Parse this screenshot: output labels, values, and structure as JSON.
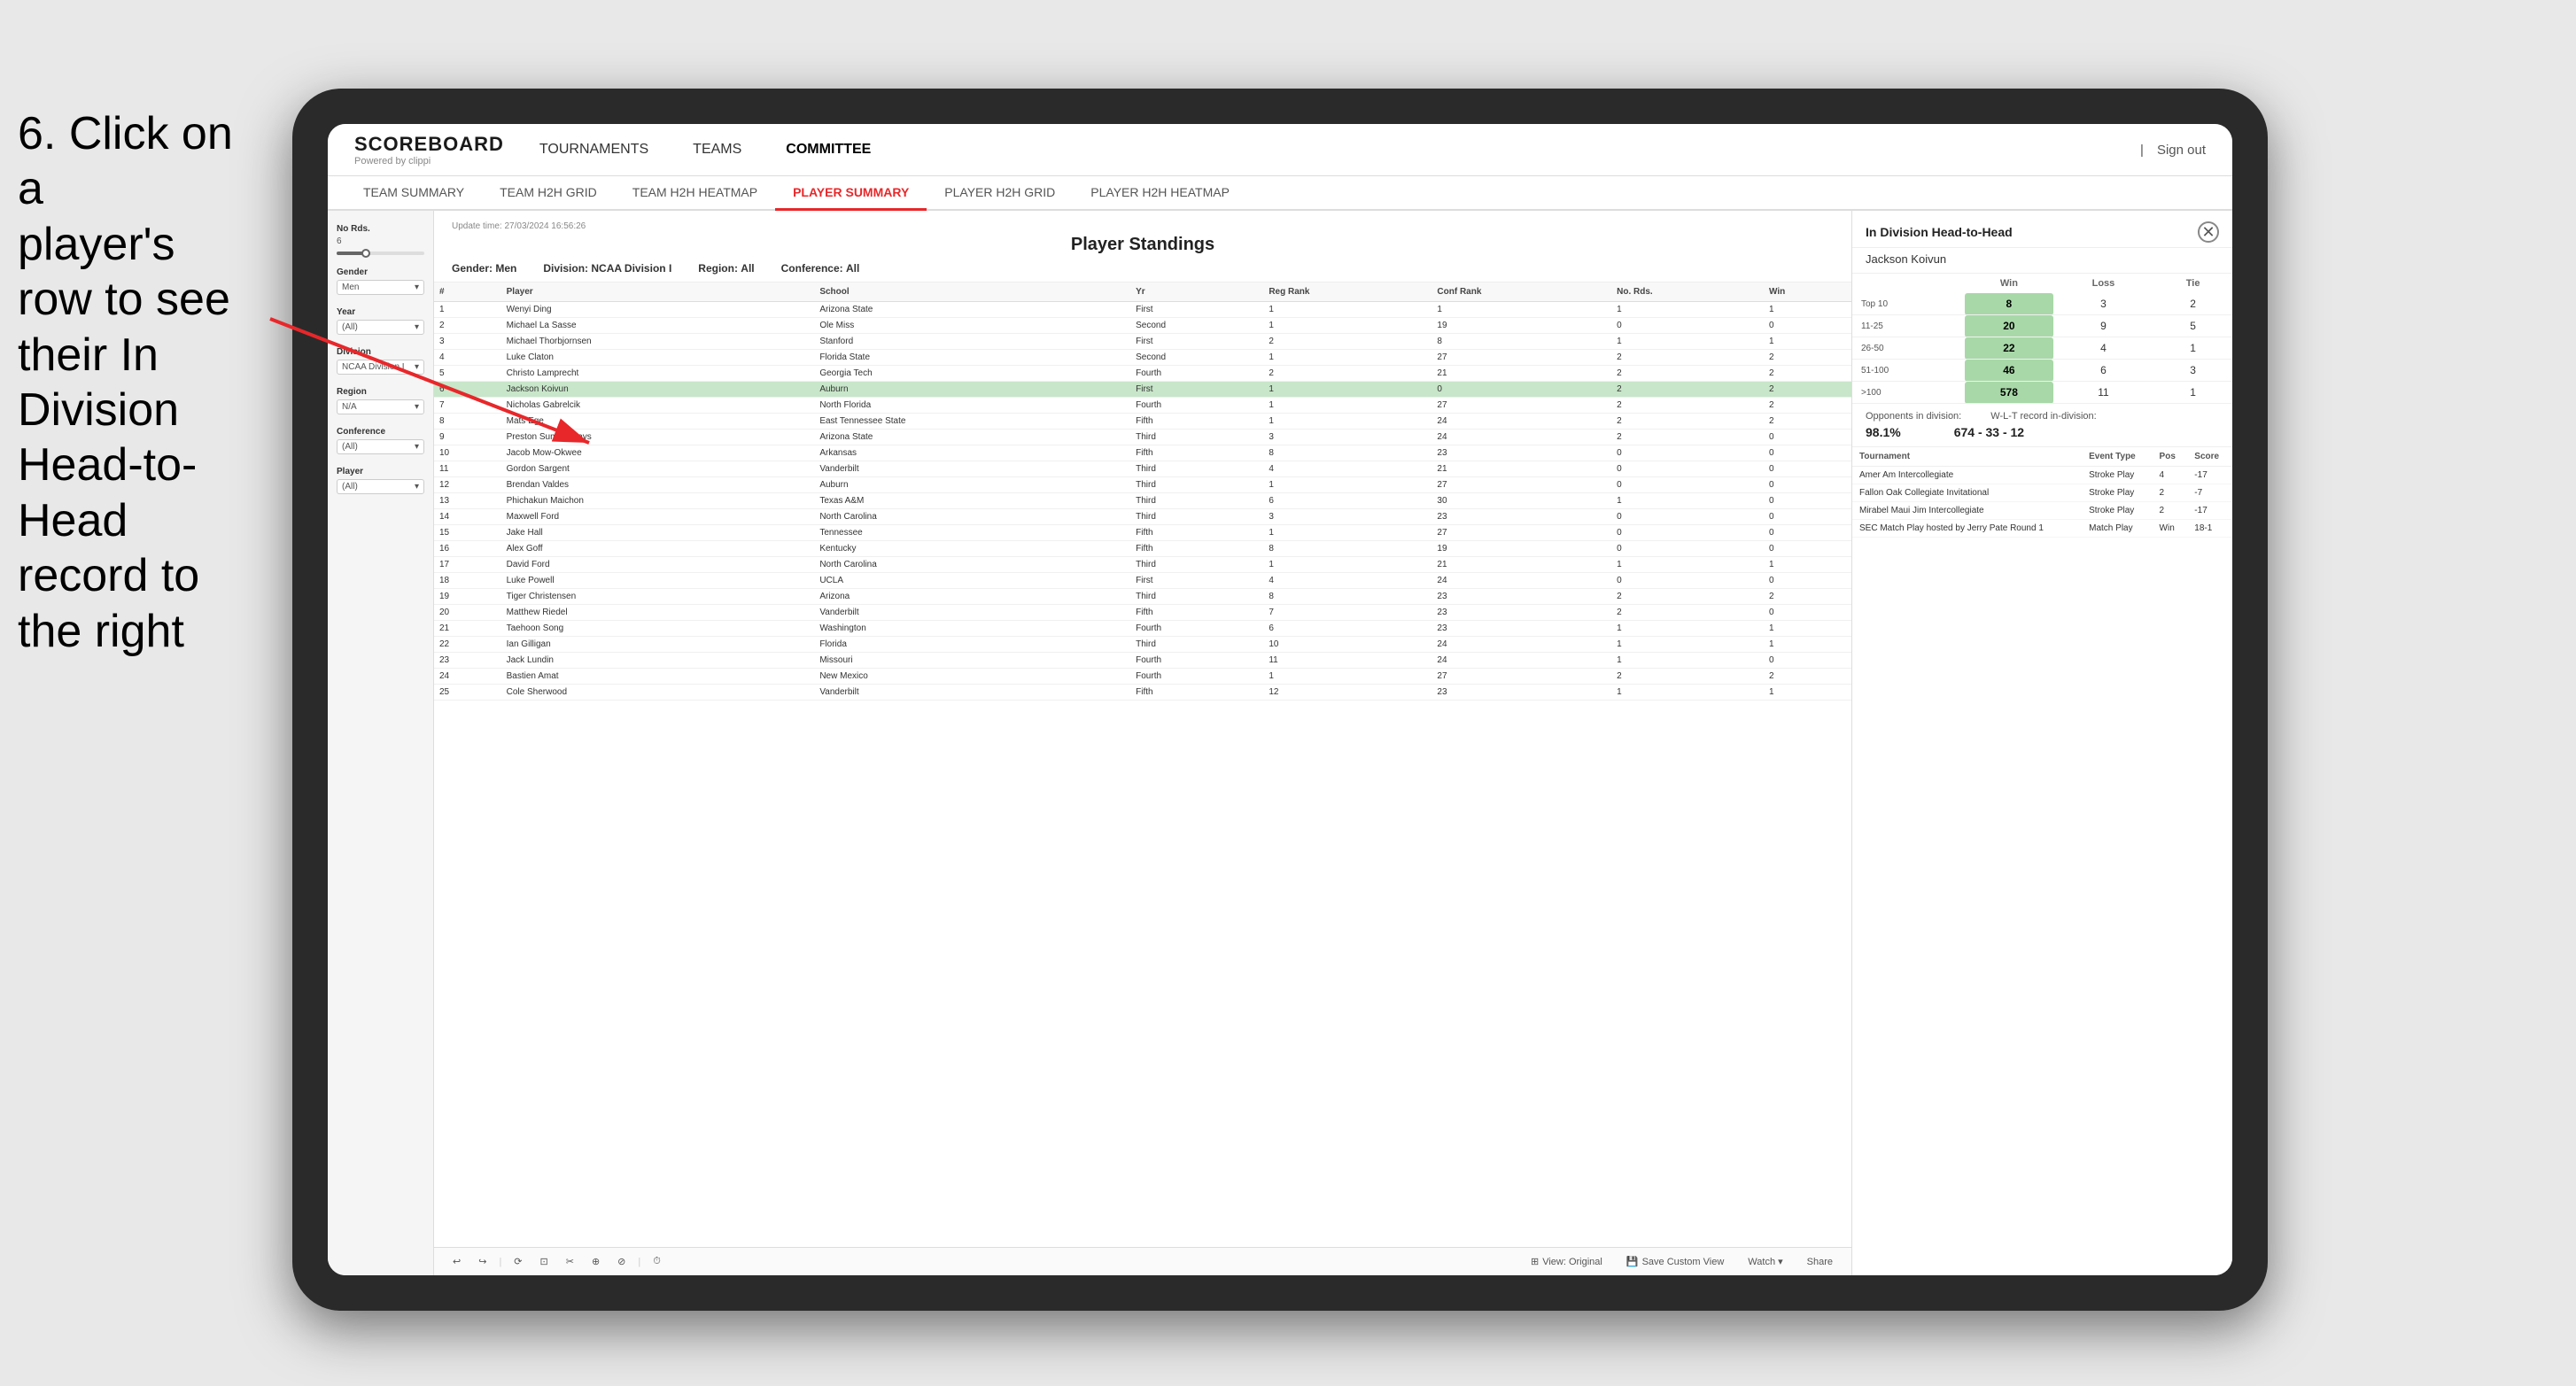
{
  "instruction": {
    "line1": "6. Click on a",
    "line2": "player's row to see",
    "line3": "their In Division",
    "line4": "Head-to-Head",
    "line5": "record to the right"
  },
  "nav": {
    "logo_main": "SCOREBOARD",
    "logo_sub": "Powered by clippi",
    "items": [
      "TOURNAMENTS",
      "TEAMS",
      "COMMITTEE"
    ],
    "sign_out": "Sign out"
  },
  "subnav": {
    "items": [
      "TEAM SUMMARY",
      "TEAM H2H GRID",
      "TEAM H2H HEATMAP",
      "PLAYER SUMMARY",
      "PLAYER H2H GRID",
      "PLAYER H2H HEATMAP"
    ],
    "active": "PLAYER SUMMARY"
  },
  "filters": {
    "no_rds_label": "No Rds.",
    "no_rds_value": "6",
    "gender_label": "Gender",
    "gender_value": "Men",
    "year_label": "Year",
    "year_value": "(All)",
    "division_label": "Division",
    "division_value": "NCAA Division I",
    "region_label": "Region",
    "region_value": "N/A",
    "conference_label": "Conference",
    "conference_value": "(All)",
    "player_label": "Player",
    "player_value": "(All)"
  },
  "table": {
    "update_time": "Update time:",
    "update_datetime": "27/03/2024 16:56:26",
    "title": "Player Standings",
    "gender_label": "Gender:",
    "gender_value": "Men",
    "division_label": "Division:",
    "division_value": "NCAA Division I",
    "region_label": "Region:",
    "region_value": "All",
    "conference_label": "Conference:",
    "conference_value": "All",
    "columns": [
      "#",
      "Player",
      "School",
      "Yr",
      "Reg Rank",
      "Conf Rank",
      "No. Rds.",
      "Win"
    ],
    "rows": [
      {
        "num": 1,
        "player": "Wenyi Ding",
        "school": "Arizona State",
        "yr": "First",
        "reg": 1,
        "conf": 1,
        "rds": 1,
        "win": 1
      },
      {
        "num": 2,
        "player": "Michael La Sasse",
        "school": "Ole Miss",
        "yr": "Second",
        "reg": 1,
        "conf": 19,
        "rds": 0,
        "win": 0
      },
      {
        "num": 3,
        "player": "Michael Thorbjornsen",
        "school": "Stanford",
        "yr": "First",
        "reg": 2,
        "conf": 8,
        "rds": 1,
        "win": 1
      },
      {
        "num": 4,
        "player": "Luke Claton",
        "school": "Florida State",
        "yr": "Second",
        "reg": 1,
        "conf": 27,
        "rds": 2,
        "win": 2
      },
      {
        "num": 5,
        "player": "Christo Lamprecht",
        "school": "Georgia Tech",
        "yr": "Fourth",
        "reg": 2,
        "conf": 21,
        "rds": 2,
        "win": 2
      },
      {
        "num": 6,
        "player": "Jackson Koivun",
        "school": "Auburn",
        "yr": "First",
        "reg": 1,
        "conf": 0,
        "rds": 2,
        "win": 2
      },
      {
        "num": 7,
        "player": "Nicholas Gabrelcik",
        "school": "North Florida",
        "yr": "Fourth",
        "reg": 1,
        "conf": 27,
        "rds": 2,
        "win": 2
      },
      {
        "num": 8,
        "player": "Mats Ege",
        "school": "East Tennessee State",
        "yr": "Fifth",
        "reg": 1,
        "conf": 24,
        "rds": 2,
        "win": 2
      },
      {
        "num": 9,
        "player": "Preston Summerhays",
        "school": "Arizona State",
        "yr": "Third",
        "reg": 3,
        "conf": 24,
        "rds": 2,
        "win": 0
      },
      {
        "num": 10,
        "player": "Jacob Mow-Okwee",
        "school": "Arkansas",
        "yr": "Fifth",
        "reg": 8,
        "conf": 23,
        "rds": 0,
        "win": 0
      },
      {
        "num": 11,
        "player": "Gordon Sargent",
        "school": "Vanderbilt",
        "yr": "Third",
        "reg": 4,
        "conf": 21,
        "rds": 0,
        "win": 0
      },
      {
        "num": 12,
        "player": "Brendan Valdes",
        "school": "Auburn",
        "yr": "Third",
        "reg": 1,
        "conf": 27,
        "rds": 0,
        "win": 0
      },
      {
        "num": 13,
        "player": "Phichakun Maichon",
        "school": "Texas A&M",
        "yr": "Third",
        "reg": 6,
        "conf": 30,
        "rds": 1,
        "win": 0
      },
      {
        "num": 14,
        "player": "Maxwell Ford",
        "school": "North Carolina",
        "yr": "Third",
        "reg": 3,
        "conf": 23,
        "rds": 0,
        "win": 0
      },
      {
        "num": 15,
        "player": "Jake Hall",
        "school": "Tennessee",
        "yr": "Fifth",
        "reg": 1,
        "conf": 27,
        "rds": 0,
        "win": 0
      },
      {
        "num": 16,
        "player": "Alex Goff",
        "school": "Kentucky",
        "yr": "Fifth",
        "reg": 8,
        "conf": 19,
        "rds": 0,
        "win": 0
      },
      {
        "num": 17,
        "player": "David Ford",
        "school": "North Carolina",
        "yr": "Third",
        "reg": 1,
        "conf": 21,
        "rds": 1,
        "win": 1
      },
      {
        "num": 18,
        "player": "Luke Powell",
        "school": "UCLA",
        "yr": "First",
        "reg": 4,
        "conf": 24,
        "rds": 0,
        "win": 0
      },
      {
        "num": 19,
        "player": "Tiger Christensen",
        "school": "Arizona",
        "yr": "Third",
        "reg": 8,
        "conf": 23,
        "rds": 2,
        "win": 2
      },
      {
        "num": 20,
        "player": "Matthew Riedel",
        "school": "Vanderbilt",
        "yr": "Fifth",
        "reg": 7,
        "conf": 23,
        "rds": 2,
        "win": 0
      },
      {
        "num": 21,
        "player": "Taehoon Song",
        "school": "Washington",
        "yr": "Fourth",
        "reg": 6,
        "conf": 23,
        "rds": 1,
        "win": 1
      },
      {
        "num": 22,
        "player": "Ian Gilligan",
        "school": "Florida",
        "yr": "Third",
        "reg": 10,
        "conf": 24,
        "rds": 1,
        "win": 1
      },
      {
        "num": 23,
        "player": "Jack Lundin",
        "school": "Missouri",
        "yr": "Fourth",
        "reg": 11,
        "conf": 24,
        "rds": 1,
        "win": 0
      },
      {
        "num": 24,
        "player": "Bastien Amat",
        "school": "New Mexico",
        "yr": "Fourth",
        "reg": 1,
        "conf": 27,
        "rds": 2,
        "win": 2
      },
      {
        "num": 25,
        "player": "Cole Sherwood",
        "school": "Vanderbilt",
        "yr": "Fifth",
        "reg": 12,
        "conf": 23,
        "rds": 1,
        "win": 1
      }
    ]
  },
  "toolbar": {
    "undo": "↩",
    "redo": "↪",
    "icons": [
      "⟳",
      "⊡",
      "⊟",
      "⊕",
      "⊘"
    ],
    "view_original": "View: Original",
    "save_custom": "Save Custom View",
    "watch": "Watch ▾",
    "share": "Share"
  },
  "right_panel": {
    "title": "In Division Head-to-Head",
    "player_name": "Jackson Koivun",
    "h2h_columns": [
      "Win",
      "Loss",
      "Tie"
    ],
    "h2h_rows": [
      {
        "range": "Top 10",
        "win": 8,
        "loss": 3,
        "tie": 2
      },
      {
        "range": "11-25",
        "win": 20,
        "loss": 9,
        "tie": 5
      },
      {
        "range": "26-50",
        "win": 22,
        "loss": 4,
        "tie": 1
      },
      {
        "range": "51-100",
        "win": 46,
        "loss": 6,
        "tie": 3
      },
      {
        "range": ">100",
        "win": 578,
        "loss": 11,
        "tie": 1
      }
    ],
    "opponents_label": "Opponents in division:",
    "opponents_value": "98.1%",
    "record_label": "W-L-T record in-division:",
    "record_value": "674 - 33 - 12",
    "tournament_columns": [
      "Tournament",
      "Event Type",
      "Pos",
      "Score"
    ],
    "tournament_rows": [
      {
        "tournament": "Amer Am Intercollegiate",
        "type": "Stroke Play",
        "pos": 4,
        "score": "-17"
      },
      {
        "tournament": "Fallon Oak Collegiate Invitational",
        "type": "Stroke Play",
        "pos": 2,
        "score": "-7"
      },
      {
        "tournament": "Mirabel Maui Jim Intercollegiate",
        "type": "Stroke Play",
        "pos": 2,
        "score": "-17"
      },
      {
        "tournament": "SEC Match Play hosted by Jerry Pate Round 1",
        "type": "Match Play",
        "pos": "Win",
        "score": "18-1"
      }
    ]
  }
}
